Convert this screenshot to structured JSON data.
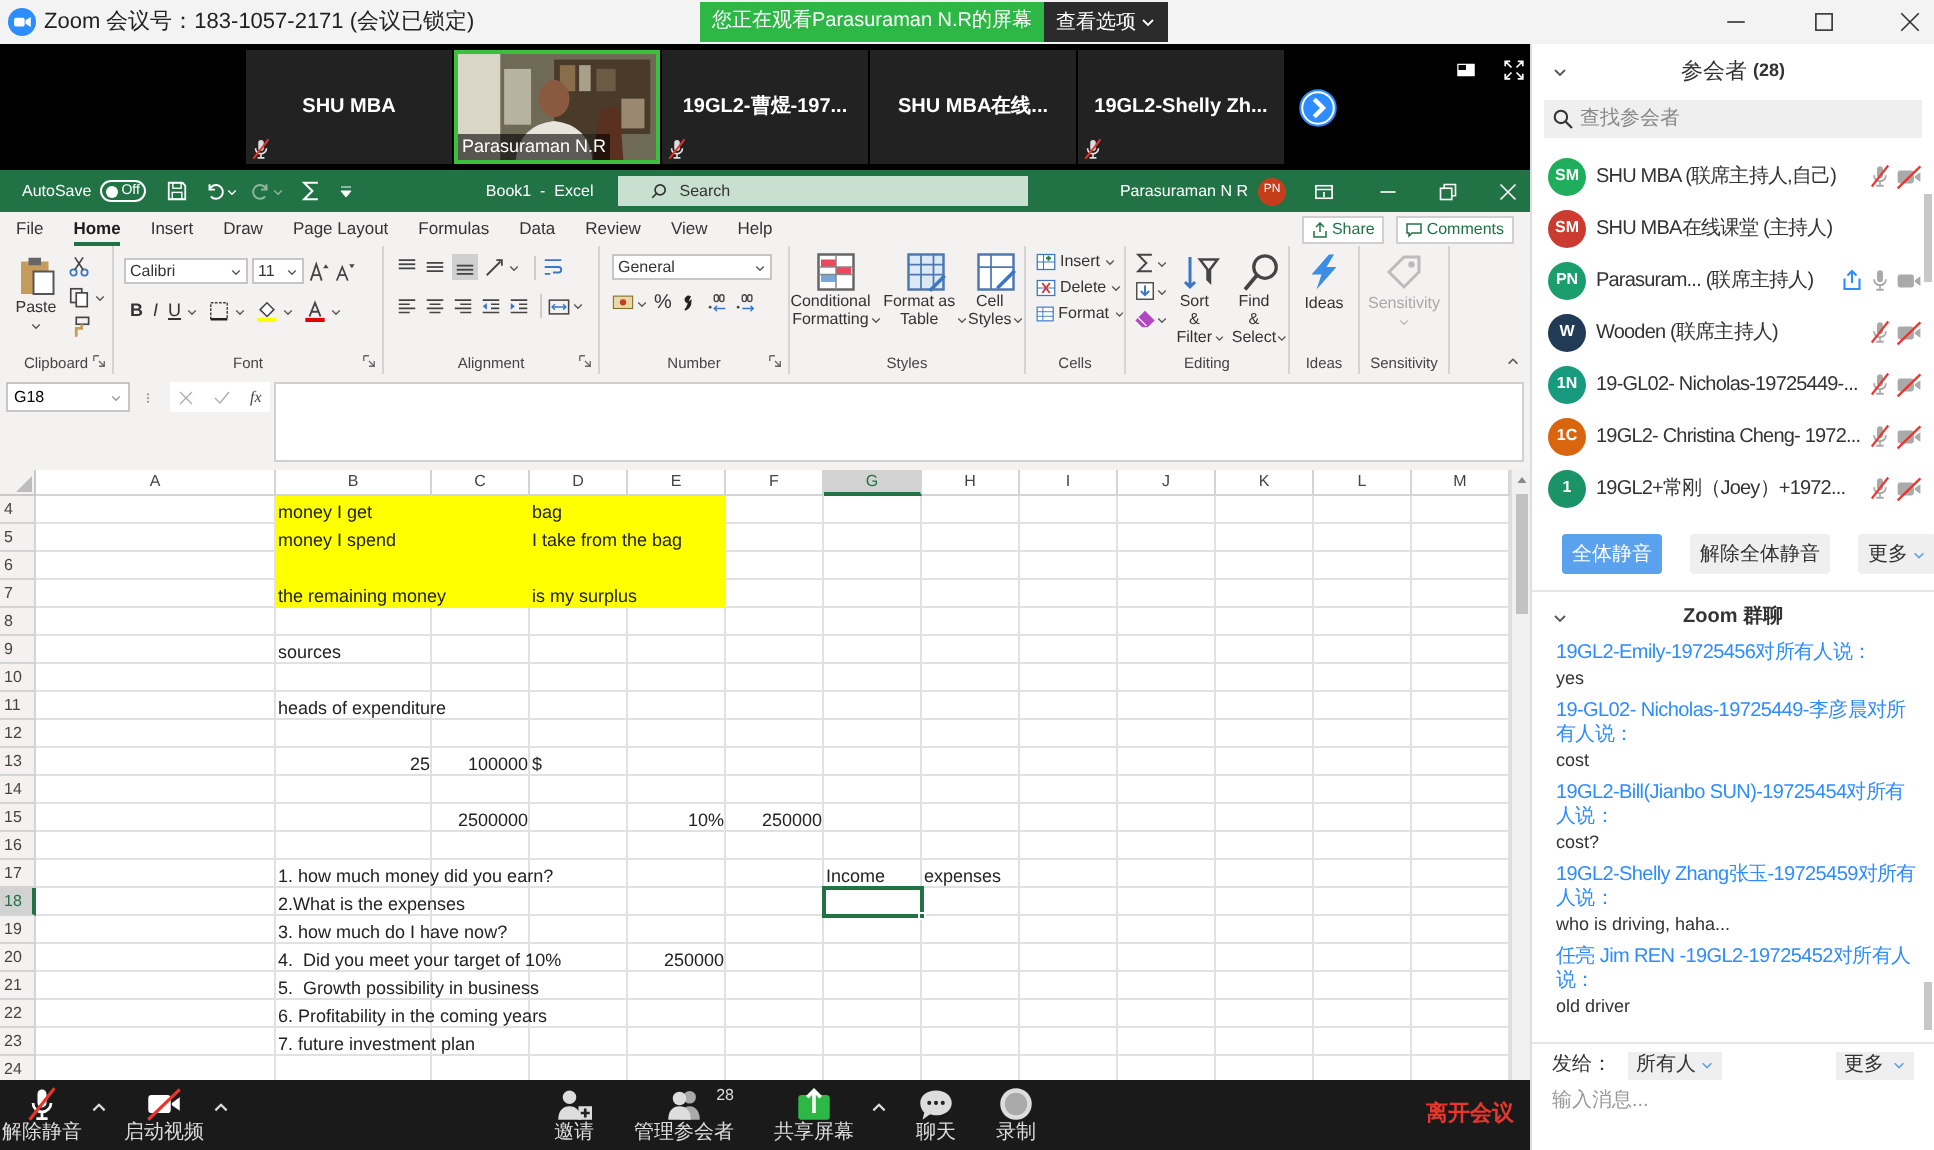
{
  "window": {
    "title": "Zoom 会议号：183-1057-2171  (会议已锁定)"
  },
  "banner": {
    "text": "您正在观看Parasuraman  N.R的屏幕",
    "button": "查看选项"
  },
  "video_strip": {
    "tiles": [
      {
        "kind": "name",
        "name": "SHU MBA",
        "muted": true,
        "highlighted": false
      },
      {
        "kind": "video",
        "name": "Parasuraman N.R",
        "muted": false,
        "highlighted": true
      },
      {
        "kind": "name",
        "name": "19GL2-曹煜-197...",
        "muted": true,
        "highlighted": false
      },
      {
        "kind": "name",
        "name": "SHU  MBA在线...",
        "muted": false,
        "highlighted": false
      },
      {
        "kind": "name",
        "name": "19GL2-Shelly  Zh...",
        "muted": true,
        "highlighted": false
      }
    ]
  },
  "excel": {
    "autosave": {
      "label": "AutoSave",
      "state": "Off",
      "on": false
    },
    "title": "Book1  -  Excel",
    "search": {
      "placeholder": "Search"
    },
    "user": {
      "name": "Parasuraman N R",
      "initials": "PN"
    },
    "tabs": [
      {
        "label": "File",
        "selected": false
      },
      {
        "label": "Home",
        "selected": true
      },
      {
        "label": "Insert",
        "selected": false
      },
      {
        "label": "Draw",
        "selected": false
      },
      {
        "label": "Page Layout",
        "selected": false
      },
      {
        "label": "Formulas",
        "selected": false
      },
      {
        "label": "Data",
        "selected": false
      },
      {
        "label": "Review",
        "selected": false
      },
      {
        "label": "View",
        "selected": false
      },
      {
        "label": "Help",
        "selected": false
      }
    ],
    "share": "Share",
    "comments": "Comments",
    "ribbon": {
      "clipboard": {
        "label": "Clipboard",
        "paste": "Paste"
      },
      "font": {
        "label": "Font",
        "family": "Calibri",
        "size": "11",
        "bold": "B",
        "italic": "I",
        "underline": "U"
      },
      "alignment": {
        "label": "Alignment"
      },
      "number": {
        "label": "Number",
        "format": "General",
        "percent": "%"
      },
      "styles": {
        "label": "Styles",
        "buttons": [
          "Conditional\nFormatting",
          "Format as\nTable",
          "Cell\nStyles"
        ]
      },
      "cells": {
        "label": "Cells",
        "buttons": [
          "Insert",
          "Delete",
          "Format"
        ]
      },
      "editing": {
        "label": "Editing",
        "buttons": [
          "Sort &\nFilter",
          "Find &\nSelect"
        ]
      },
      "ideas": {
        "label": "Ideas",
        "button": "Ideas"
      },
      "sensitivity": {
        "label": "Sensitivity",
        "button": "Sensitivity",
        "disabled": true
      }
    },
    "formula_bar": {
      "name_box": "G18",
      "function_label": "fx"
    },
    "sheet": {
      "columns": [
        "A",
        "B",
        "C",
        "D",
        "E",
        "F",
        "G",
        "H",
        "I",
        "J",
        "K",
        "L",
        "M"
      ],
      "rows": [
        {
          "number": "4",
          "cells": [
            {
              "text": ""
            },
            {
              "kind": "text",
              "text": "money I get",
              "color": "#ffff00"
            },
            {
              "text": "",
              "color": "#ffff00"
            },
            {
              "kind": "text",
              "text": "bag",
              "color": "#ffff00"
            },
            {
              "text": "",
              "color": "#ffff00"
            }
          ]
        },
        {
          "number": "5",
          "cells": [
            {
              "text": ""
            },
            {
              "kind": "text",
              "text": "money I spend",
              "color": "#ffff00"
            },
            {
              "text": "",
              "color": "#ffff00"
            },
            {
              "kind": "text",
              "text": "I take from the bag",
              "color": "#ffff00"
            },
            {
              "text": "",
              "color": "#ffff00"
            }
          ]
        },
        {
          "number": "6",
          "cells": [
            {
              "text": ""
            },
            {
              "text": "",
              "color": "#ffff00"
            },
            {
              "text": "",
              "color": "#ffff00"
            },
            {
              "text": "",
              "color": "#ffff00"
            },
            {
              "text": "",
              "color": "#ffff00"
            }
          ]
        },
        {
          "number": "7",
          "cells": [
            {
              "text": ""
            },
            {
              "kind": "text",
              "text": "the remaining money",
              "color": "#ffff00"
            },
            {
              "text": "",
              "color": "#ffff00"
            },
            {
              "kind": "text",
              "text": "is my surplus",
              "color": "#ffff00"
            },
            {
              "text": "",
              "color": "#ffff00"
            }
          ]
        },
        {
          "number": "8",
          "cells": []
        },
        {
          "number": "9",
          "cells": [
            {
              "text": ""
            },
            {
              "kind": "text",
              "text": "sources"
            }
          ]
        },
        {
          "number": "10",
          "cells": []
        },
        {
          "number": "11",
          "cells": [
            {
              "text": ""
            },
            {
              "kind": "text",
              "text": "heads of expenditure"
            }
          ]
        },
        {
          "number": "12",
          "cells": []
        },
        {
          "number": "13",
          "cells": [
            {
              "text": ""
            },
            {
              "kind": "number",
              "text": "25"
            },
            {
              "kind": "number",
              "text": "100000"
            },
            {
              "kind": "text",
              "text": "$"
            }
          ]
        },
        {
          "number": "14",
          "cells": []
        },
        {
          "number": "15",
          "cells": [
            {
              "text": ""
            },
            {
              "text": ""
            },
            {
              "kind": "number",
              "text": "2500000"
            },
            {
              "text": ""
            },
            {
              "kind": "number",
              "text": "10%"
            },
            {
              "kind": "number",
              "text": "250000"
            }
          ]
        },
        {
          "number": "16",
          "cells": []
        },
        {
          "number": "17",
          "cells": [
            {
              "text": ""
            },
            {
              "kind": "text",
              "text": "1. how much money did you earn?"
            },
            {
              "text": ""
            },
            {
              "text": ""
            },
            {
              "text": ""
            },
            {
              "text": ""
            },
            {
              "kind": "text",
              "text": "Income"
            },
            {
              "kind": "text",
              "text": "expenses"
            }
          ]
        },
        {
          "number": "18",
          "cells": [
            {
              "text": ""
            },
            {
              "kind": "text",
              "text": "2.What is the expenses"
            },
            {
              "text": ""
            },
            {
              "text": ""
            },
            {
              "text": ""
            },
            {
              "text": ""
            },
            {
              "text": "",
              "selected": true
            }
          ]
        },
        {
          "number": "19",
          "cells": [
            {
              "text": ""
            },
            {
              "kind": "text",
              "text": "3. how much do I have now?"
            }
          ]
        },
        {
          "number": "20",
          "cells": [
            {
              "text": ""
            },
            {
              "kind": "text",
              "text": "4.  Did you meet your target of 10%"
            },
            {
              "text": ""
            },
            {
              "text": ""
            },
            {
              "kind": "number",
              "text": "250000"
            }
          ]
        },
        {
          "number": "21",
          "cells": [
            {
              "text": ""
            },
            {
              "kind": "text",
              "text": "5.  Growth possibility in business"
            }
          ]
        },
        {
          "number": "22",
          "cells": [
            {
              "text": ""
            },
            {
              "kind": "text",
              "text": "6. Profitability in the coming years"
            }
          ]
        },
        {
          "number": "23",
          "cells": [
            {
              "text": ""
            },
            {
              "kind": "text",
              "text": "7. future investment plan"
            }
          ]
        },
        {
          "number": "24",
          "cells": []
        }
      ]
    }
  },
  "participants": {
    "title": "参会者",
    "count": "(28)",
    "search": {
      "placeholder": "查找参会者"
    },
    "list": [
      {
        "kind": "media",
        "initials": "SM",
        "color": "#1fae5b",
        "name": "SHU MBA (联席主持人,自己)",
        "sharing": false,
        "mic_muted": true,
        "video_off": true
      },
      {
        "kind": "plain",
        "initials": "SM",
        "color": "#cc3b30",
        "name": "SHU MBA在线课堂 (主持人)",
        "sharing": false
      },
      {
        "kind": "media",
        "initials": "PN",
        "color": "#1a9e6e",
        "name": "Parasuram... (联席主持人)",
        "sharing": true,
        "mic_muted": false,
        "video_off": false
      },
      {
        "kind": "media",
        "initials": "W",
        "color": "#213a56",
        "name": "Wooden (联席主持人)",
        "sharing": false,
        "mic_muted": true,
        "video_off": true
      },
      {
        "kind": "media",
        "initials": "1N",
        "color": "#179a7d",
        "name": "19-GL02- Nicholas-19725449-...",
        "sharing": false,
        "mic_muted": true,
        "video_off": true
      },
      {
        "kind": "media",
        "initials": "1C",
        "color": "#d9650f",
        "name": "19GL2- Christina Cheng- 1972...",
        "sharing": false,
        "mic_muted": true,
        "video_off": true
      },
      {
        "kind": "media",
        "initials": "1",
        "color": "#1a9368",
        "name": "19GL2+常刚（Joey）+1972...",
        "sharing": false,
        "mic_muted": true,
        "video_off": true
      }
    ],
    "buttons": [
      {
        "label": "全体静音",
        "kind": "primary"
      },
      {
        "label": "解除全体静音",
        "kind": "plain"
      },
      {
        "label": "更多",
        "kind": "menu"
      }
    ]
  },
  "chat": {
    "title": "Zoom 群聊",
    "messages": [
      {
        "sender": "19GL2-Emily-19725456对所有人说：",
        "text": "yes"
      },
      {
        "sender": "19-GL02- Nicholas-19725449-李彦晨对所有人说：",
        "text": "cost"
      },
      {
        "sender": "19GL2-Bill(Jianbo SUN)-19725454对所有人说：",
        "text": "cost?"
      },
      {
        "sender": "19GL2-Shelly Zhang张玉-19725459对所有人说：",
        "text": "who is driving, haha..."
      },
      {
        "sender": "任亮 Jim REN -19GL2-19725452对所有人说：",
        "text": "old driver"
      }
    ],
    "send_to_label": "发给：",
    "recipient": "所有人",
    "more": "更多",
    "input": {
      "placeholder": "输入消息..."
    }
  },
  "toolbar": {
    "left_items": [
      {
        "kind": "mic_muted",
        "label": "解除静音"
      },
      {
        "kind": "video_off",
        "label": "启动视频"
      }
    ],
    "center_items": [
      {
        "kind": "invite",
        "label": "邀请"
      },
      {
        "kind": "participants",
        "label": "管理参会者",
        "badge": "28"
      },
      {
        "kind": "share",
        "label": "共享屏幕"
      },
      {
        "kind": "chat",
        "label": "聊天"
      },
      {
        "kind": "record",
        "label": "录制"
      }
    ],
    "leave": "离开会议"
  }
}
